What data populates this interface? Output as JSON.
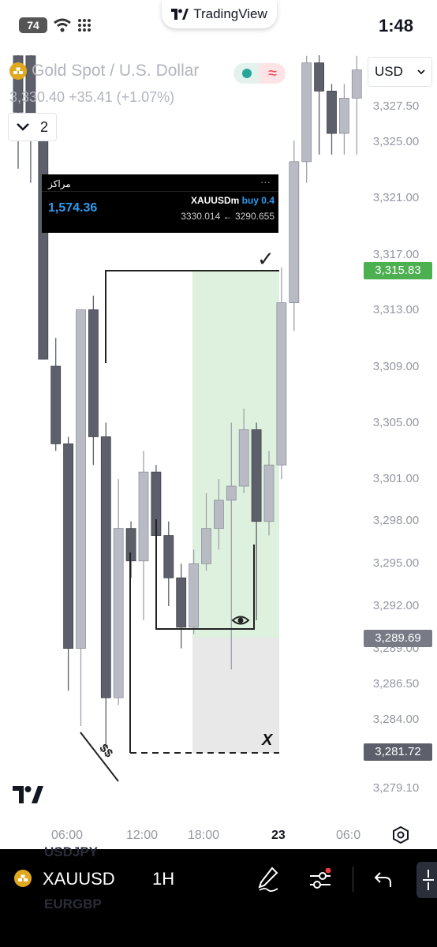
{
  "status_bar": {
    "battery": "74",
    "time": "1:48",
    "app_name": "TradingView"
  },
  "legend": {
    "symbol_name": "Gold Spot / U.S. Dollar",
    "price_line": "3,330.40 +35.41 (+1.07%)",
    "indicator_count": "2",
    "currency": "USD",
    "colors": {
      "market_open": "#26a69a",
      "wave": "#f23645"
    }
  },
  "overlay": {
    "title": "مراكز",
    "menu": "···",
    "balance": "1,574.36",
    "position_symbol": "XAUUSDm",
    "position_side": "buy 0.4",
    "price_range": "3330.014 ← 3290.655"
  },
  "price_axis": {
    "labels": [
      "3,327.50",
      "3,325.00",
      "3,321.00",
      "3,317.00",
      "3,313.00",
      "3,309.00",
      "3,305.00",
      "3,301.00",
      "3,298.00",
      "3,295.00",
      "3,292.00",
      "3,289.00",
      "3,286.50",
      "3,284.00",
      "3,279.10"
    ],
    "current_price_tag": "3,315.83",
    "entry_price_tag": "3,289.69",
    "stop_price_tag": "3,281.72",
    "colors": {
      "current": "#4caf50",
      "entry": "#787b86",
      "stop": "#5d606b"
    }
  },
  "time_axis": {
    "labels": [
      "06:00",
      "12:00",
      "18:00",
      "23",
      "06:0"
    ]
  },
  "annotations": {
    "checkmark": "✓",
    "dollar_note": "$$",
    "x_mark": "X"
  },
  "chart_data": {
    "type": "candlestick",
    "symbol": "XAUUSD",
    "timeframe": "1H",
    "ylim": [
      3278,
      3332
    ],
    "candles": [
      {
        "o": 3331.0,
        "h": 3334.0,
        "l": 3323.0,
        "c": 3327.0
      },
      {
        "o": 3331.0,
        "h": 3333.0,
        "l": 3322.0,
        "c": 3325.5
      },
      {
        "o": 3325.5,
        "h": 3326.0,
        "l": 3312.0,
        "c": 3309.5
      },
      {
        "o": 3309.0,
        "h": 3311.0,
        "l": 3303.0,
        "c": 3303.5
      },
      {
        "o": 3303.5,
        "h": 3304.0,
        "l": 3286.0,
        "c": 3289.0
      },
      {
        "o": 3289.0,
        "h": 3311.0,
        "l": 3283.5,
        "c": 3313.0
      },
      {
        "o": 3313.0,
        "h": 3314.0,
        "l": 3302.0,
        "c": 3304.0
      },
      {
        "o": 3304.0,
        "h": 3305.0,
        "l": 3282.0,
        "c": 3285.5
      },
      {
        "o": 3285.5,
        "h": 3301.0,
        "l": 3285.0,
        "c": 3297.5
      },
      {
        "o": 3297.5,
        "h": 3298.0,
        "l": 3294.0,
        "c": 3295.2
      },
      {
        "o": 3295.2,
        "h": 3303.0,
        "l": 3291.0,
        "c": 3301.5
      },
      {
        "o": 3301.5,
        "h": 3302.0,
        "l": 3296.0,
        "c": 3297.0
      },
      {
        "o": 3297.0,
        "h": 3298.0,
        "l": 3292.0,
        "c": 3294.0
      },
      {
        "o": 3294.0,
        "h": 3295.0,
        "l": 3289.0,
        "c": 3290.5
      },
      {
        "o": 3290.5,
        "h": 3296.0,
        "l": 3290.0,
        "c": 3295.0
      },
      {
        "o": 3295.0,
        "h": 3300.0,
        "l": 3294.5,
        "c": 3297.5
      },
      {
        "o": 3297.5,
        "h": 3301.0,
        "l": 3296.0,
        "c": 3299.5
      },
      {
        "o": 3299.5,
        "h": 3305.0,
        "l": 3287.5,
        "c": 3300.5
      },
      {
        "o": 3300.5,
        "h": 3306.0,
        "l": 3300.0,
        "c": 3304.5
      },
      {
        "o": 3304.5,
        "h": 3305.0,
        "l": 3291.0,
        "c": 3298.0
      },
      {
        "o": 3298.0,
        "h": 3303.0,
        "l": 3297.0,
        "c": 3302.0
      },
      {
        "o": 3302.0,
        "h": 3316.0,
        "l": 3301.0,
        "c": 3313.5
      },
      {
        "o": 3313.5,
        "h": 3325.0,
        "l": 3311.5,
        "c": 3323.5
      },
      {
        "o": 3323.5,
        "h": 3331.0,
        "l": 3322.0,
        "c": 3330.5
      },
      {
        "o": 3330.5,
        "h": 3332.0,
        "l": 3324.0,
        "c": 3328.5
      },
      {
        "o": 3328.5,
        "h": 3329.0,
        "l": 3324.0,
        "c": 3325.5
      },
      {
        "o": 3325.5,
        "h": 3329.0,
        "l": 3324.0,
        "c": 3328.0
      },
      {
        "o": 3328.0,
        "h": 3331.0,
        "l": 3324.0,
        "c": 3330.0
      }
    ],
    "long_position": {
      "entry": 3289.69,
      "target": 3316.9,
      "stop": 3281.72
    }
  },
  "bottom_bar": {
    "symbol": "XAUUSD",
    "timeframe": "1H",
    "ghost_above": "USDJPY",
    "ghost_below": "EURGBP"
  }
}
